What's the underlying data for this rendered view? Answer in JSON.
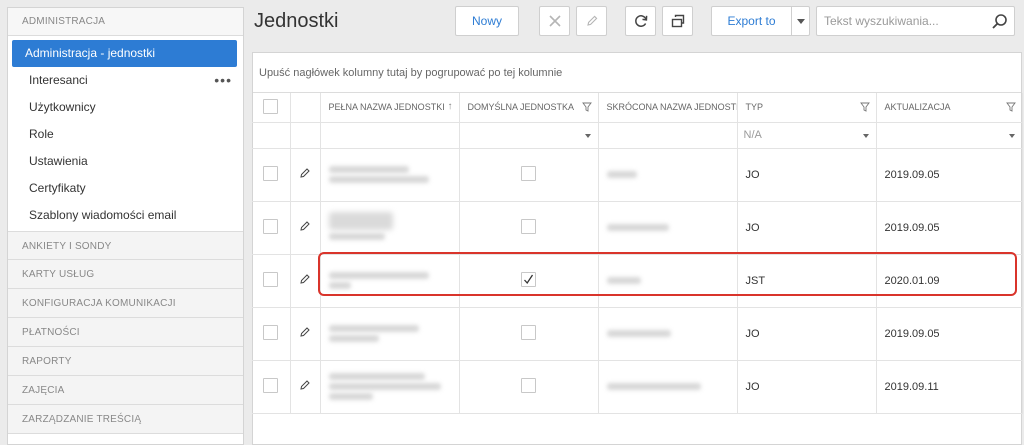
{
  "sidebar": {
    "section_title": "ADMINISTRACJA",
    "items": [
      {
        "label": "Administracja - jednostki",
        "active": true
      },
      {
        "label": "Interesanci",
        "more_icon": "more-horizontal-icon"
      },
      {
        "label": "Użytkownicy"
      },
      {
        "label": "Role"
      },
      {
        "label": "Ustawienia"
      },
      {
        "label": "Certyfikaty"
      },
      {
        "label": "Szablony wiadomości email"
      }
    ],
    "categories": [
      "ANKIETY I SONDY",
      "KARTY USŁUG",
      "KONFIGURACJA KOMUNIKACJI",
      "PŁATNOŚCI",
      "RAPORTY",
      "ZAJĘCIA",
      "ZARZĄDZANIE TREŚCIĄ"
    ]
  },
  "page": {
    "title": "Jednostki"
  },
  "toolbar": {
    "new_label": "Nowy",
    "delete_icon": "close-icon",
    "edit_icon": "pencil-icon",
    "refresh_icon": "refresh-icon",
    "columns_icon": "column-chooser-icon",
    "export_label": "Export to",
    "export_dropdown_icon": "caret-down-icon"
  },
  "search": {
    "placeholder": "Tekst wyszukiwania...",
    "value": "",
    "icon": "search-icon"
  },
  "grid": {
    "group_panel_text": "Upuść nagłówek kolumny tutaj by pogrupować po tej kolumnie",
    "columns": [
      {
        "key": "select",
        "label": ""
      },
      {
        "key": "edit",
        "label": ""
      },
      {
        "key": "full_name",
        "label": "PEŁNA NAZWA JEDNOSTKI",
        "sort": "ascending"
      },
      {
        "key": "default_unit",
        "label": "DOMYŚLNA JEDNOSTKA",
        "filter": true
      },
      {
        "key": "short_name",
        "label": "SKRÓCONA NAZWA JEDNOSTKI"
      },
      {
        "key": "type",
        "label": "TYP",
        "filter": true
      },
      {
        "key": "updated",
        "label": "AKTUALIZACJA",
        "filter": true
      }
    ],
    "filter_row": {
      "default_unit": "",
      "type": "N/A",
      "updated": ""
    },
    "rows": [
      {
        "full_name": "(blurred)",
        "default_unit": false,
        "short_name": "(blurred)",
        "type": "JO",
        "updated": "2019.09.05"
      },
      {
        "full_name": "(blurred)",
        "default_unit": false,
        "short_name": "(blurred)",
        "type": "JO",
        "updated": "2019.09.05"
      },
      {
        "full_name": "(blurred)",
        "default_unit": true,
        "short_name": "(blurred)",
        "type": "JST",
        "updated": "2020.01.09",
        "highlighted": true
      },
      {
        "full_name": "(blurred)",
        "default_unit": false,
        "short_name": "(blurred)",
        "type": "JO",
        "updated": "2019.09.05"
      },
      {
        "full_name": "(blurred)",
        "default_unit": false,
        "short_name": "(blurred)",
        "type": "JO",
        "updated": "2019.09.11"
      }
    ]
  },
  "colors": {
    "accent": "#2d7cd4",
    "highlight": "#d9342b"
  }
}
